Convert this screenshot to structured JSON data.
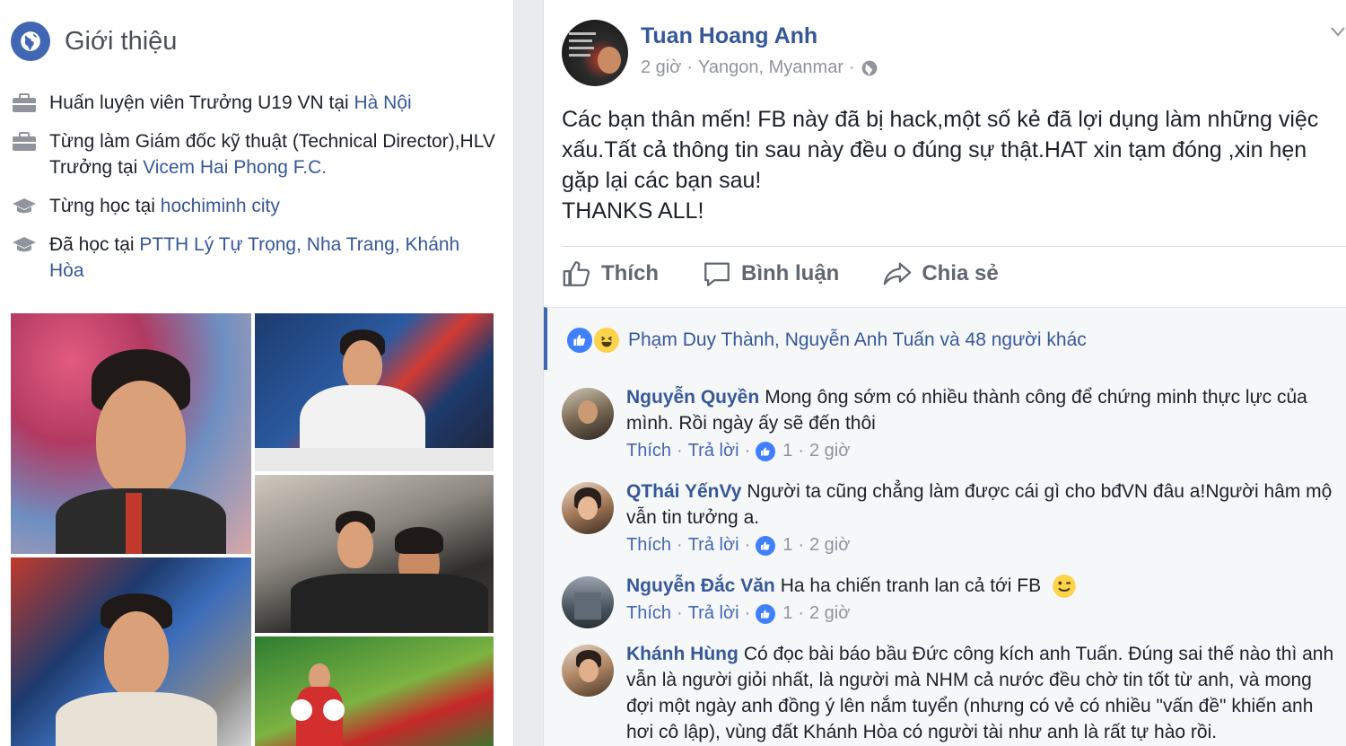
{
  "intro": {
    "title": "Giới thiệu",
    "items": [
      {
        "icon": "briefcase-icon",
        "prefix": "Huấn luyện viên Trưởng U19 VN tại ",
        "link": "Hà Nội"
      },
      {
        "icon": "briefcase-icon",
        "prefix": "Từng làm Giám đốc kỹ thuật (Technical Director),HLV Trưởng tại ",
        "link": "Vicem Hai Phong F.C."
      },
      {
        "icon": "graduation-cap-icon",
        "prefix": "Từng học tại ",
        "link": "hochiminh city"
      },
      {
        "icon": "graduation-cap-icon",
        "prefix": "Đã học tại ",
        "link": "PTTH Lý Tự Trọng, Nha Trang, Khánh Hòa"
      }
    ]
  },
  "post": {
    "author": "Tuan Hoang Anh",
    "time": "2 giờ",
    "sep": "·",
    "location": "Yangon, Myanmar",
    "text_lines": [
      "Các bạn thân mến! FB này đã bị hack,một số kẻ đã lợi dụng làm những việc",
      "xấu.Tất cả thông tin sau này đều o đúng sự thật.HAT xin tạm đóng ,xin hẹn",
      "gặp lại các bạn sau!",
      "THANKS ALL!"
    ],
    "actions": {
      "like": "Thích",
      "comment": "Bình luận",
      "share": "Chia sẻ"
    },
    "reactions_text": "Phạm Duy Thành, Nguyễn Anh Tuấn và 48 người khác"
  },
  "comments": [
    {
      "name": "Nguyễn Quyền",
      "text": "Mong ông sớm có nhiều thành công để chứng minh thực lực của mình. Rồi ngày ấy sẽ đến thôi",
      "like": "Thích",
      "reply": "Trả lời",
      "count": "1",
      "time": "2 giờ"
    },
    {
      "name": "QThái YếnVy",
      "text": "Người ta cũng chẳng làm được cái gì cho bđVN đâu a!Người hâm mộ vẫn tin tưởng a.",
      "like": "Thích",
      "reply": "Trả lời",
      "count": "1",
      "time": "2 giờ"
    },
    {
      "name": "Nguyễn Đắc Văn",
      "text": "Ha ha chiến tranh lan cả tới FB",
      "like": "Thích",
      "reply": "Trả lời",
      "count": "1",
      "time": "2 giờ"
    },
    {
      "name": "Khánh Hùng",
      "text": "Có đọc bài báo bầu Đức công kích anh Tuấn. Đúng sai thế nào thì anh vẫn là người giỏi nhất, là người mà NHM cả nước đều chờ tin tốt từ anh, và mong đợi một ngày anh đồng ý lên nắm tuyển (nhưng có vẻ có nhiều \"vấn đề\" khiến anh hơi cô lập), vùng đất Khánh Hòa có người tài như anh là rất tự hào rồi."
    }
  ],
  "colors": {
    "link": "#365899",
    "brand": "#4267b2",
    "muted": "#90949c",
    "like_blue": "#4080ff"
  }
}
